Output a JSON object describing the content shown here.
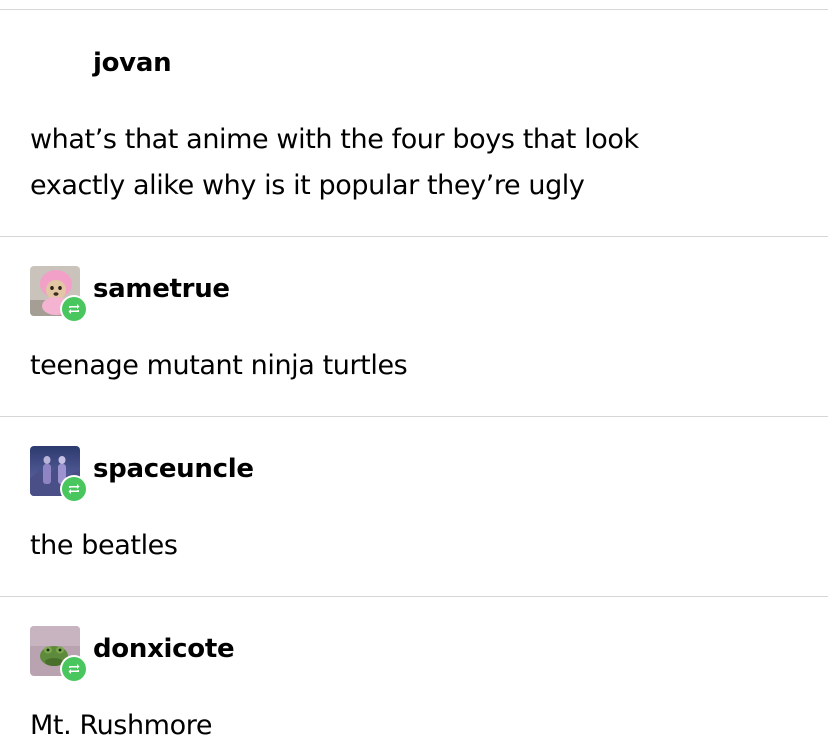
{
  "thread": {
    "posts": [
      {
        "username": "jovan",
        "avatar": "",
        "reblog": false,
        "lines": [
          "what’s that anime with the four boys that look",
          "exactly alike why is it popular they’re ugly"
        ]
      },
      {
        "username": "sametrue",
        "avatar": "puppy-in-pink-hood-avatar",
        "reblog": true,
        "lines": [
          "teenage mutant ninja turtles"
        ]
      },
      {
        "username": "spaceuncle",
        "avatar": "two-figures-night-sky-avatar",
        "reblog": true,
        "lines": [
          "the beatles"
        ]
      },
      {
        "username": "donxicote",
        "avatar": "green-frog-avatar",
        "reblog": true,
        "lines": [
          "Mt. Rushmore"
        ]
      }
    ]
  },
  "icons": {
    "reblog": "reblog-icon"
  },
  "colors": {
    "reblog_badge": "#49c65d",
    "divider": "#d6d6d6",
    "text": "#000000",
    "background": "#ffffff"
  }
}
